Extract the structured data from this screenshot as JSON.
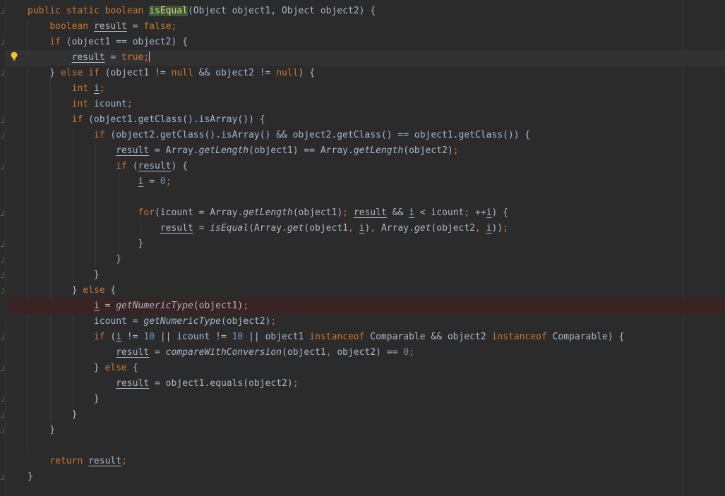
{
  "code": {
    "lines": [
      {
        "segs": [
          {
            "t": "public static boolean ",
            "c": "kw"
          },
          {
            "t": "isEqual",
            "c": "hl"
          },
          {
            "t": "(Object object1, Object object2) {",
            "c": ""
          }
        ]
      },
      {
        "segs": [
          {
            "t": "    ",
            "c": ""
          },
          {
            "t": "boolean ",
            "c": "kw"
          },
          {
            "t": "result",
            "c": "u"
          },
          {
            "t": " = ",
            "c": ""
          },
          {
            "t": "false",
            "c": "kw"
          },
          {
            "t": ";",
            "c": "kw"
          }
        ]
      },
      {
        "segs": [
          {
            "t": "    ",
            "c": ""
          },
          {
            "t": "if ",
            "c": "kw"
          },
          {
            "t": "(object1 == object2) {",
            "c": ""
          }
        ]
      },
      {
        "segs": [
          {
            "t": "        ",
            "c": ""
          },
          {
            "t": "result",
            "c": "u"
          },
          {
            "t": " = ",
            "c": ""
          },
          {
            "t": "true",
            "c": "kw"
          },
          {
            "t": ";",
            "c": "kw"
          },
          {
            "t": "",
            "c": "caret"
          }
        ]
      },
      {
        "segs": [
          {
            "t": "    } ",
            "c": ""
          },
          {
            "t": "else if ",
            "c": "kw"
          },
          {
            "t": "(object1 != ",
            "c": ""
          },
          {
            "t": "null ",
            "c": "kw"
          },
          {
            "t": "&& object2 != ",
            "c": ""
          },
          {
            "t": "null",
            "c": "kw"
          },
          {
            "t": ") {",
            "c": ""
          }
        ]
      },
      {
        "segs": [
          {
            "t": "        ",
            "c": ""
          },
          {
            "t": "int ",
            "c": "kw"
          },
          {
            "t": "i",
            "c": "u"
          },
          {
            "t": ";",
            "c": "kw"
          }
        ]
      },
      {
        "segs": [
          {
            "t": "        ",
            "c": ""
          },
          {
            "t": "int ",
            "c": "kw"
          },
          {
            "t": "icount",
            "c": ""
          },
          {
            "t": ";",
            "c": "kw"
          }
        ]
      },
      {
        "segs": [
          {
            "t": "        ",
            "c": ""
          },
          {
            "t": "if ",
            "c": "kw"
          },
          {
            "t": "(object1.getClass().isArray()) {",
            "c": ""
          }
        ]
      },
      {
        "segs": [
          {
            "t": "            ",
            "c": ""
          },
          {
            "t": "if ",
            "c": "kw"
          },
          {
            "t": "(object2.getClass().isArray() && object2.getClass() == object1.getClass()) {",
            "c": ""
          }
        ]
      },
      {
        "segs": [
          {
            "t": "                ",
            "c": ""
          },
          {
            "t": "result",
            "c": "u"
          },
          {
            "t": " = Array.",
            "c": ""
          },
          {
            "t": "getLength",
            "c": "it"
          },
          {
            "t": "(object1) == Array.",
            "c": ""
          },
          {
            "t": "getLength",
            "c": "it"
          },
          {
            "t": "(object2)",
            "c": ""
          },
          {
            "t": ";",
            "c": "kw"
          }
        ]
      },
      {
        "segs": [
          {
            "t": "                ",
            "c": ""
          },
          {
            "t": "if ",
            "c": "kw"
          },
          {
            "t": "(",
            "c": ""
          },
          {
            "t": "result",
            "c": "u"
          },
          {
            "t": ") {",
            "c": ""
          }
        ]
      },
      {
        "segs": [
          {
            "t": "                    ",
            "c": ""
          },
          {
            "t": "i",
            "c": "u"
          },
          {
            "t": " = ",
            "c": ""
          },
          {
            "t": "0",
            "c": "num"
          },
          {
            "t": ";",
            "c": "kw"
          }
        ]
      },
      {
        "segs": []
      },
      {
        "segs": [
          {
            "t": "                    ",
            "c": ""
          },
          {
            "t": "for",
            "c": "kw"
          },
          {
            "t": "(icount = Array.",
            "c": ""
          },
          {
            "t": "getLength",
            "c": "it"
          },
          {
            "t": "(object1)",
            "c": ""
          },
          {
            "t": "; ",
            "c": "kw"
          },
          {
            "t": "result",
            "c": "u"
          },
          {
            "t": " && ",
            "c": ""
          },
          {
            "t": "i",
            "c": "u"
          },
          {
            "t": " < icount",
            "c": ""
          },
          {
            "t": "; ",
            "c": "kw"
          },
          {
            "t": "++",
            "c": ""
          },
          {
            "t": "i",
            "c": "u"
          },
          {
            "t": ") {",
            "c": ""
          }
        ]
      },
      {
        "segs": [
          {
            "t": "                        ",
            "c": ""
          },
          {
            "t": "result",
            "c": "u"
          },
          {
            "t": " = ",
            "c": ""
          },
          {
            "t": "isEqual",
            "c": "it"
          },
          {
            "t": "(Array.",
            "c": ""
          },
          {
            "t": "get",
            "c": "it"
          },
          {
            "t": "(object1",
            "c": ""
          },
          {
            "t": ", ",
            "c": "kw"
          },
          {
            "t": "i",
            "c": "u"
          },
          {
            "t": ")",
            "c": ""
          },
          {
            "t": ", ",
            "c": "kw"
          },
          {
            "t": "Array.",
            "c": ""
          },
          {
            "t": "get",
            "c": "it"
          },
          {
            "t": "(object2",
            "c": ""
          },
          {
            "t": ", ",
            "c": "kw"
          },
          {
            "t": "i",
            "c": "u"
          },
          {
            "t": "))",
            "c": ""
          },
          {
            "t": ";",
            "c": "kw"
          }
        ]
      },
      {
        "segs": [
          {
            "t": "                    }",
            "c": ""
          }
        ]
      },
      {
        "segs": [
          {
            "t": "                }",
            "c": ""
          }
        ]
      },
      {
        "segs": [
          {
            "t": "            }",
            "c": ""
          }
        ]
      },
      {
        "segs": [
          {
            "t": "        } ",
            "c": ""
          },
          {
            "t": "else ",
            "c": "kw"
          },
          {
            "t": "{",
            "c": ""
          }
        ]
      },
      {
        "segs": [
          {
            "t": "            ",
            "c": ""
          },
          {
            "t": "i",
            "c": "u"
          },
          {
            "t": " = ",
            "c": ""
          },
          {
            "t": "getNumericType",
            "c": "it"
          },
          {
            "t": "(object1)",
            "c": ""
          },
          {
            "t": ";",
            "c": "kw"
          }
        ]
      },
      {
        "segs": [
          {
            "t": "            icount = ",
            "c": ""
          },
          {
            "t": "getNumericType",
            "c": "it"
          },
          {
            "t": "(object2)",
            "c": ""
          },
          {
            "t": ";",
            "c": "kw"
          }
        ]
      },
      {
        "segs": [
          {
            "t": "            ",
            "c": ""
          },
          {
            "t": "if ",
            "c": "kw"
          },
          {
            "t": "(",
            "c": ""
          },
          {
            "t": "i",
            "c": "u"
          },
          {
            "t": " != ",
            "c": ""
          },
          {
            "t": "10",
            "c": "num"
          },
          {
            "t": " || icount != ",
            "c": ""
          },
          {
            "t": "10",
            "c": "num"
          },
          {
            "t": " || object1 ",
            "c": ""
          },
          {
            "t": "instanceof ",
            "c": "kw"
          },
          {
            "t": "Comparable && object2 ",
            "c": ""
          },
          {
            "t": "instanceof ",
            "c": "kw"
          },
          {
            "t": "Comparable) {",
            "c": ""
          }
        ]
      },
      {
        "segs": [
          {
            "t": "                ",
            "c": ""
          },
          {
            "t": "result",
            "c": "u"
          },
          {
            "t": " = ",
            "c": ""
          },
          {
            "t": "compareWithConversion",
            "c": "it"
          },
          {
            "t": "(object1",
            "c": ""
          },
          {
            "t": ", ",
            "c": "kw"
          },
          {
            "t": "object2) == ",
            "c": ""
          },
          {
            "t": "0",
            "c": "num"
          },
          {
            "t": ";",
            "c": "kw"
          }
        ]
      },
      {
        "segs": [
          {
            "t": "            } ",
            "c": ""
          },
          {
            "t": "else ",
            "c": "kw"
          },
          {
            "t": "{",
            "c": ""
          }
        ]
      },
      {
        "segs": [
          {
            "t": "                ",
            "c": ""
          },
          {
            "t": "result",
            "c": "u"
          },
          {
            "t": " = object1.equals(object2)",
            "c": ""
          },
          {
            "t": ";",
            "c": "kw"
          }
        ]
      },
      {
        "segs": [
          {
            "t": "            }",
            "c": ""
          }
        ]
      },
      {
        "segs": [
          {
            "t": "        }",
            "c": ""
          }
        ]
      },
      {
        "segs": [
          {
            "t": "    }",
            "c": ""
          }
        ]
      },
      {
        "segs": []
      },
      {
        "segs": [
          {
            "t": "    ",
            "c": ""
          },
          {
            "t": "return ",
            "c": "kw"
          },
          {
            "t": "result",
            "c": "u"
          },
          {
            "t": ";",
            "c": "kw"
          }
        ]
      },
      {
        "segs": [
          {
            "t": "}",
            "c": ""
          }
        ]
      }
    ]
  },
  "editor": {
    "caret_line": 4,
    "breakpoint_line": 20,
    "colors": {
      "background": "#2b2b2b",
      "text": "#a9b7c6",
      "keyword": "#cc7832",
      "number": "#6897bb",
      "method_highlight": "#ffc66d",
      "breakpoint_line": "#3a2323",
      "caret_line": "#323232"
    },
    "icons": [
      "intention-bulb-icon",
      "fold-marker-icon"
    ]
  }
}
